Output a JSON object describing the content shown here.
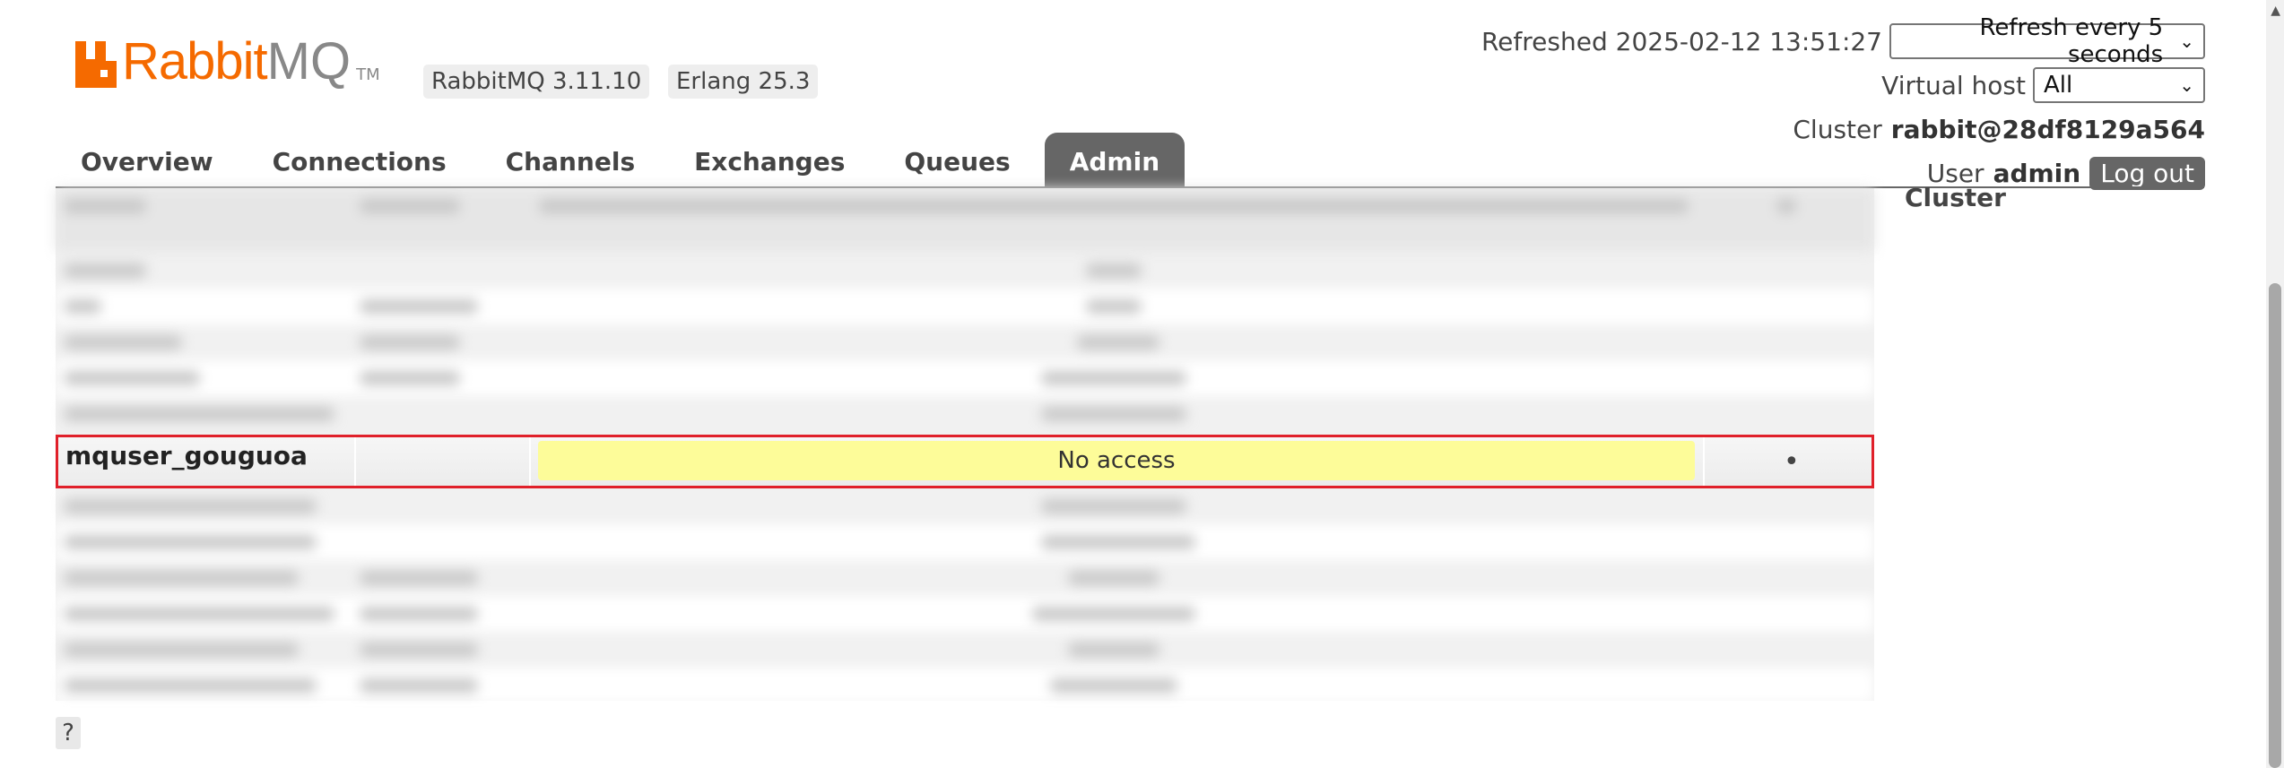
{
  "brand": {
    "name_part1": "Rabbit",
    "name_part2": "MQ",
    "tm": "TM",
    "color": "#f56a00"
  },
  "versions": {
    "rabbitmq": "RabbitMQ 3.11.10",
    "erlang": "Erlang 25.3"
  },
  "header": {
    "refreshed_label": "Refreshed 2025-02-12 13:51:27",
    "refresh_select": "Refresh every 5 seconds",
    "vhost_label": "Virtual host",
    "vhost_select": "All",
    "cluster_label": "Cluster",
    "cluster_name": "rabbit@28df8129a564",
    "user_label": "User",
    "user_name": "admin",
    "logout": "Log out"
  },
  "tabs": [
    {
      "label": "Overview",
      "active": false
    },
    {
      "label": "Connections",
      "active": false
    },
    {
      "label": "Channels",
      "active": false
    },
    {
      "label": "Exchanges",
      "active": false
    },
    {
      "label": "Queues",
      "active": false
    },
    {
      "label": "Admin",
      "active": true
    }
  ],
  "sidebar": {
    "cluster": "Cluster"
  },
  "highlighted_row": {
    "user": "mquser_gouguoa",
    "access": "No access",
    "dot": "•",
    "highlight_color": "#e0202a",
    "access_bg": "#fdfc99"
  },
  "help": "?"
}
